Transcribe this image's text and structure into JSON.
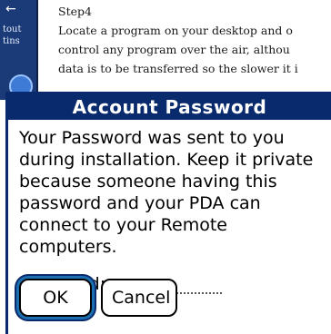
{
  "background_app": {
    "side_arrow": "←",
    "side_text_lines": [
      "tout",
      "tins"
    ],
    "text_lines": [
      "Step4",
      "Locate a program on your desktop and o",
      "control any program over the air, althou",
      "data is to be transferred so the slower it i"
    ]
  },
  "dialog": {
    "title": "Account Password",
    "message": "Your Password was sent to you during installation.  Keep it private because someone having this password and your PDA can connect to your Remote computers.",
    "password_label": "Password:",
    "password_value": "",
    "ok_label": "OK",
    "cancel_label": "Cancel"
  },
  "colors": {
    "title_bar": "#0a2a6e",
    "focus_ring": "#1b6fb0",
    "side_strip": "#1a3a78"
  }
}
